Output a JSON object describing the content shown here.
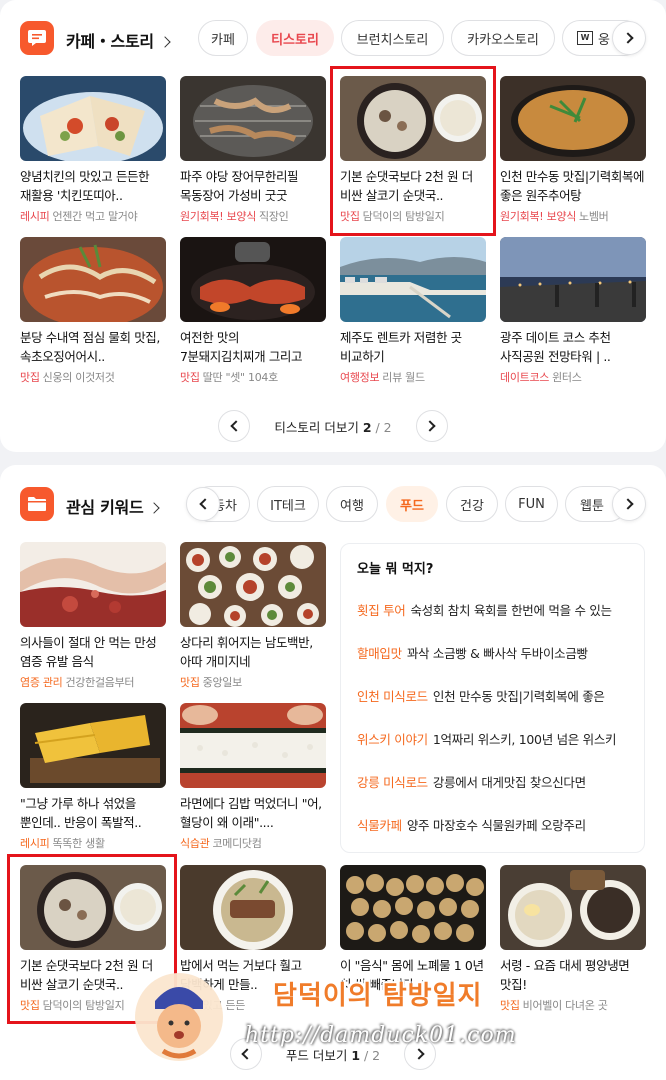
{
  "card1": {
    "title": "카페・스토리",
    "tabs": [
      "카페",
      "티스토리",
      "브런치스토리",
      "카카오스토리",
      "웅"
    ],
    "active_tab": "티스토리",
    "items": [
      {
        "title": "양념치킨의 맛있고 든든한 재활용 '치킨또띠아..",
        "category": "레시피",
        "source": "언젠간 먹고 말거야"
      },
      {
        "title": "파주 야당 장어무한리필 목동장어 가성비 굿굿",
        "category": "원기회복! 보양식",
        "source": "직장인"
      },
      {
        "title": "기본 순댓국보다 2천 원 더 비싼 살코기 순댓국..",
        "category": "맛집",
        "source": "담덕이의 탐방일지"
      },
      {
        "title": "인천 만수동 맛집|기력회복에 좋은 원주추어탕",
        "category": "원기회복! 보양식",
        "source": "노벰버"
      },
      {
        "title": "분당 수내역 점심 물회 맛집, 속초오징어어시..",
        "category": "맛집",
        "source": "신웅의 이것저것"
      },
      {
        "title": "여전한 맛의 7분돼지김치찌개 그리고 열탄불..",
        "category": "맛집",
        "source": "딸딴 \"셋\" 104호"
      },
      {
        "title": "제주도 렌트카 저렴한 곳 비교하기",
        "category": "여행정보",
        "source": "리뷰 월드"
      },
      {
        "title": "광주 데이트 코스 추천 사직공원 전망타워 | ..",
        "category": "데이트코스",
        "source": "윈터스"
      }
    ],
    "pager": {
      "label": "티스토리 더보기",
      "current": "2",
      "total": "/ 2"
    }
  },
  "card2": {
    "title": "관심 키워드",
    "tabs": [
      "동차",
      "IT테크",
      "여행",
      "푸드",
      "건강",
      "FUN",
      "웹툰"
    ],
    "active_tab": "푸드",
    "items": [
      {
        "title": "의사들이 절대 안 먹는 만성 염증 유발 음식",
        "category": "염증 관리",
        "source": "건강한걸음부터"
      },
      {
        "title": "상다리 휘어지는 남도백반, 아따 개미지네",
        "category": "맛집",
        "source": "중앙일보"
      },
      {
        "title": "\"그냥 가루 하나 섞었을 뿐인데.. 반응이 폭발적..",
        "category": "레시피",
        "source": "똑똑한 생활"
      },
      {
        "title": "라면에다 김밥 먹었더니 \"어, 혈당이 왜 이래\"....",
        "category": "식습관",
        "source": "코메디닷컴"
      },
      {
        "title": "기본 순댓국보다 2천 원 더 비싼 살코기 순댓국..",
        "category": "맛집",
        "source": "담덕이의 탐방일지"
      },
      {
        "title": "밥에서 먹는 거보다 훨고 담백하게 만들..",
        "category": "",
        "source": "재미있고 든든"
      },
      {
        "title": "이 \"음식\" 몸에 노폐물 1 0년 치 싹 빼줍니다, '..",
        "category": "",
        "source": ""
      },
      {
        "title": "서령 - 요즘 대세 평양냉면 맛집!",
        "category": "맛집",
        "source": "비어벨이 다녀온 곳"
      }
    ],
    "panel": {
      "title": "오늘 뭐 먹지?",
      "rows": [
        {
          "keyword": "횟집 투어",
          "text": "숙성회 참치 육회를 한번에 먹을 수 있는"
        },
        {
          "keyword": "할매입맛",
          "text": "꽈삭 소금빵 & 빠사삭 두바이소금빵"
        },
        {
          "keyword": "인천 미식로드",
          "text": "인천 만수동 맛집|기력회복에 좋은"
        },
        {
          "keyword": "위스키 이야기",
          "text": "1억짜리 위스키, 100년 넘은 위스키"
        },
        {
          "keyword": "강릉 미식로드",
          "text": "강릉에서 대게맛집 찾으신다면"
        },
        {
          "keyword": "식물카페",
          "text": "양주 마장호수 식물원카페 오랑주리"
        }
      ]
    },
    "pager": {
      "label": "푸드 더보기",
      "current": "1",
      "total": "/ 2"
    }
  },
  "watermark": {
    "title": "담덕이의 탐방일지",
    "url": "http://damduck01.com"
  },
  "colors": {
    "accent_red": "#e8474e",
    "accent_orange": "#f5691f",
    "highlight_box": "#e4141b"
  },
  "icons": {
    "card1": "chat-bubble-icon",
    "card2": "folder-icon"
  }
}
